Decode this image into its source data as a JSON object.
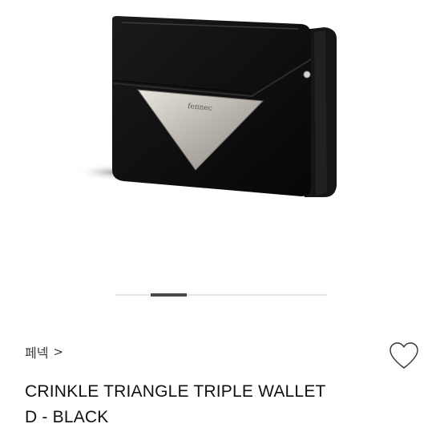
{
  "product": {
    "brand": "페넥",
    "brand_chevron": ">",
    "logo_text": "fennec",
    "name_line1": "CRINKLE TRIANGLE TRIPLE WALLET",
    "name_line2": "D - BLACK",
    "image_slide": {
      "current": 2,
      "total": 6
    }
  },
  "icons": {
    "like": "heart-outline-icon",
    "brand_chevron": "chevron-right-icon"
  },
  "colors": {
    "wallet": "#0e0e0e",
    "triangle_plate": "#b9b4ad",
    "text": "#111111",
    "indicator_active": "#4a4a4a",
    "indicator_track": "#e6e6e6"
  }
}
